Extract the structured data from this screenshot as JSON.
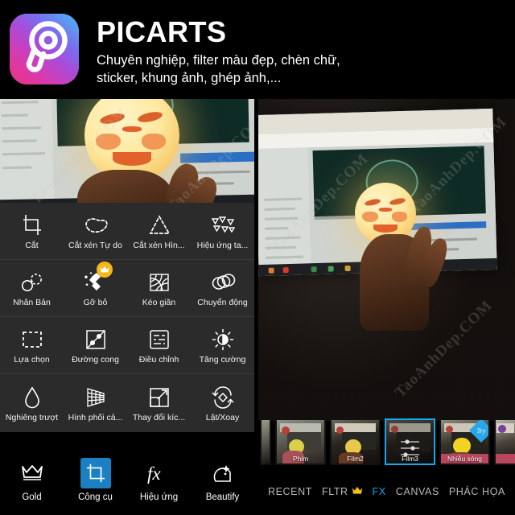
{
  "header": {
    "app_icon": "picsart-logo-icon",
    "title": "PICARTS",
    "subtitle_line1": "Chuyên nghiệp, filter màu đẹp, chèn chữ,",
    "subtitle_line2": "sticker, khung ảnh, ghép ảnh,..."
  },
  "watermark": "TaoAnhDep.COM",
  "left_panel": {
    "tool_rows": [
      {
        "tools": [
          {
            "label": "Cắt",
            "icon": "crop-icon",
            "premium": false
          },
          {
            "label": "Cắt xén Tự do",
            "icon": "free-crop-icon",
            "premium": false
          },
          {
            "label": "Cắt xén Hìn...",
            "icon": "shape-crop-icon",
            "premium": false
          },
          {
            "label": "Hiệu ứng ta...",
            "icon": "dispersion-effect-icon",
            "premium": false
          }
        ]
      },
      {
        "tools": [
          {
            "label": "Nhân Bản",
            "icon": "clone-icon",
            "premium": false
          },
          {
            "label": "Gỡ bỏ",
            "icon": "remove-icon",
            "premium": true
          },
          {
            "label": "Kéo giãn",
            "icon": "stretch-icon",
            "premium": false
          },
          {
            "label": "Chuyển động",
            "icon": "motion-icon",
            "premium": false
          }
        ]
      },
      {
        "tools": [
          {
            "label": "Lựa chọn",
            "icon": "selection-icon",
            "premium": false
          },
          {
            "label": "Đường cong",
            "icon": "curves-icon",
            "premium": false
          },
          {
            "label": "Điều chỉnh",
            "icon": "adjust-icon",
            "premium": false
          },
          {
            "label": "Tăng cường",
            "icon": "enhance-icon",
            "premium": false
          }
        ]
      },
      {
        "tools": [
          {
            "label": "Nghiêng trượt",
            "icon": "tilt-shift-icon",
            "premium": false
          },
          {
            "label": "Hình phối cả...",
            "icon": "perspective-icon",
            "premium": false
          },
          {
            "label": "Thay đổi kíc...",
            "icon": "resize-icon",
            "premium": false
          },
          {
            "label": "Lật/Xoay",
            "icon": "flip-rotate-icon",
            "premium": false
          }
        ]
      }
    ],
    "bottom_bar": [
      {
        "label": "Gold",
        "icon": "crown-icon",
        "active": false
      },
      {
        "label": "Công cụ",
        "icon": "tools-crop-icon",
        "active": true
      },
      {
        "label": "Hiệu ứng",
        "icon": "fx-icon",
        "active": false
      },
      {
        "label": "Beautify",
        "icon": "beautify-face-icon",
        "active": false
      }
    ]
  },
  "right_panel": {
    "filters": [
      {
        "name": "",
        "selected": false,
        "pink_label": false,
        "try_badge": false,
        "partial": true
      },
      {
        "name": "Phim",
        "selected": false,
        "pink_label": false,
        "try_badge": false
      },
      {
        "name": "Film2",
        "selected": false,
        "pink_label": false,
        "try_badge": false
      },
      {
        "name": "Film3",
        "selected": true,
        "pink_label": false,
        "try_badge": false
      },
      {
        "name": "Nhiễu sóng",
        "selected": false,
        "pink_label": true,
        "try_badge": true
      },
      {
        "name": "",
        "selected": false,
        "pink_label": true,
        "try_badge": false,
        "partial": true
      }
    ],
    "try_badge_label": "Try",
    "tabs": [
      {
        "label": "RECENT",
        "active": false,
        "crown": false
      },
      {
        "label": "FLTR",
        "active": false,
        "crown": true
      },
      {
        "label": "FX",
        "active": true,
        "crown": false
      },
      {
        "label": "CANVAS",
        "active": false,
        "crown": false
      },
      {
        "label": "PHÁC HỌA",
        "active": false,
        "crown": false
      }
    ]
  },
  "colors": {
    "accent_blue": "#12a5ef",
    "selected_blue": "#1b7fc4",
    "gold": "#f5b81c",
    "panel_bg": "#2b2b2b",
    "pink_label": "#b9465c"
  }
}
